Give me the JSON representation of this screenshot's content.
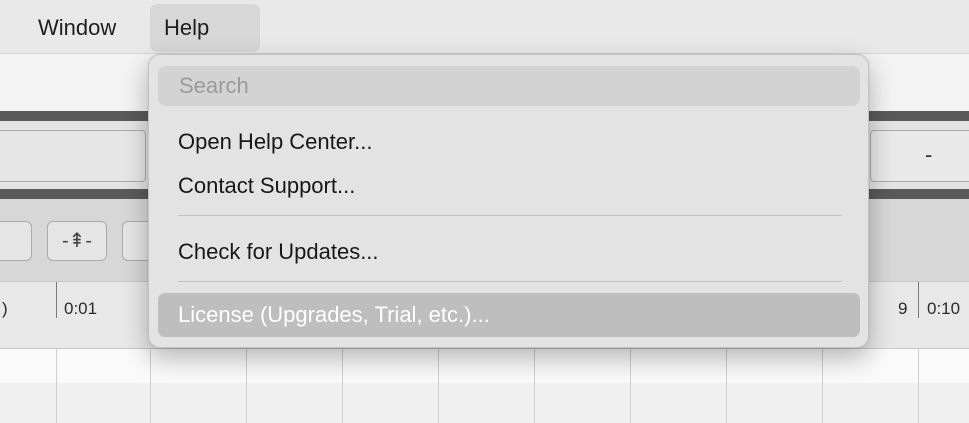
{
  "menubar": {
    "items": [
      "Window",
      "Help"
    ],
    "active": "Help"
  },
  "help_menu": {
    "search_placeholder": "Search",
    "items": [
      "Open Help Center...",
      "Contact Support...",
      "Check for Updates...",
      "License (Upgrades, Trial, etc.)..."
    ],
    "highlighted_item": "License (Upgrades, Trial, etc.)..."
  },
  "background": {
    "field_right_value": "-",
    "timeline_labels": [
      ")",
      "0:01",
      "9",
      "0:10"
    ],
    "control_icon": "-⇞-"
  },
  "colors": {
    "menubar_bg": "#e9e9e9",
    "menu_bg": "#e3e3e3",
    "highlight_bg": "#bebebe",
    "highlight_text": "#ffffff"
  },
  "icons": {
    "timeline_control": "vertical-resize-icon"
  }
}
